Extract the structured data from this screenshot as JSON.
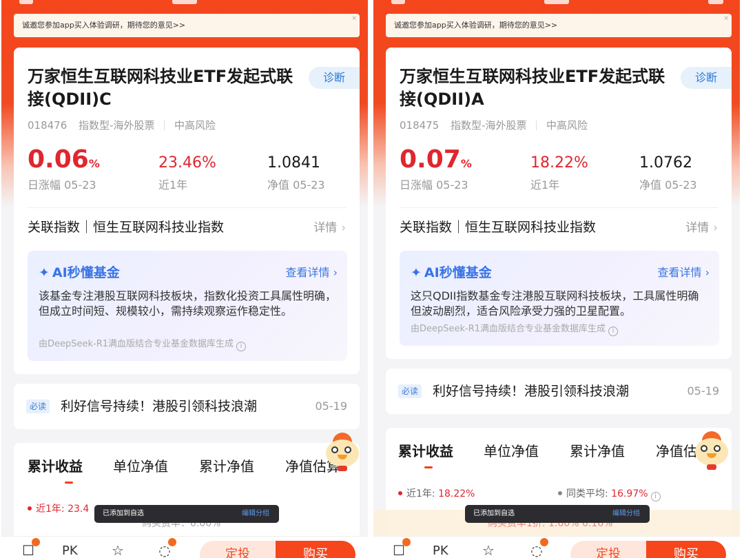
{
  "invite_banner": {
    "text": "诚邀您参加app买入体验调研，期待您的意见>>",
    "close_glyph": "×"
  },
  "panels": [
    {
      "fund": {
        "name": "万家恒生互联网科技业ETF发起式联接(QDII)C",
        "diagnose_label": "诊断",
        "code": "018476",
        "category": "指数型-海外股票",
        "risk": "中高风险",
        "daily_change_number": "0.06",
        "daily_change_unit": "%",
        "daily_change_label": "日涨幅 05-23",
        "one_year_return": "23.46%",
        "one_year_label": "近1年",
        "nav": "1.0841",
        "nav_label": "净值 05-23"
      },
      "index": {
        "label": "关联指数｜恒生互联网科技业指数",
        "detail_label": "详情",
        "chevron": "›"
      },
      "ai": {
        "spark_icon": "✦",
        "title": "AI秒懂基金",
        "more_label": "查看详情 ›",
        "body": "该基金专注港股互联网科技板块，指数化投资工具属性明确，但成立时间短、规模较小，需持续观察运作稳定性。",
        "source": "由DeepSeek-R1满血版结合专业基金数据库生成",
        "info_glyph": "i"
      },
      "news": {
        "badge": "必读",
        "title": "利好信号持续！港股引领科技浪潮",
        "date": "05-19"
      },
      "tabs": [
        "累计收益",
        "单位净值",
        "累计净值",
        "净值估算"
      ],
      "stats": {
        "one_year": "近1年: 23.4",
        "peer_avg": "",
        "peer_avg_value": ""
      },
      "toast": {
        "text": "已添加到自选",
        "action": "编辑分组"
      },
      "fee_row": "购买费率：0.00%",
      "bottom_bar": {
        "pk_label": "PK",
        "sell_label": "定投",
        "buy_label": "购买"
      }
    },
    {
      "fund": {
        "name": "万家恒生互联网科技业ETF发起式联接(QDII)A",
        "diagnose_label": "诊断",
        "code": "018475",
        "category": "指数型-海外股票",
        "risk": "中高风险",
        "daily_change_number": "0.07",
        "daily_change_unit": "%",
        "daily_change_label": "日涨幅 05-23",
        "one_year_return": "18.22%",
        "one_year_label": "近1年",
        "nav": "1.0762",
        "nav_label": "净值 05-23"
      },
      "index": {
        "label": "关联指数｜恒生互联网科技业指数",
        "detail_label": "详情",
        "chevron": "›"
      },
      "ai": {
        "spark_icon": "✦",
        "title": "AI秒懂基金",
        "more_label": "查看详情 ›",
        "body": "这只QDII指数基金专注港股互联网科技板块，工具属性明确但波动剧烈，适合风险承受力强的卫星配置。",
        "source": "由DeepSeek-R1满血版结合专业基金数据库生成",
        "info_glyph": "i"
      },
      "news": {
        "badge": "必读",
        "title": "利好信号持续！港股引领科技浪潮",
        "date": "05-19"
      },
      "tabs": [
        "累计收益",
        "单位净值",
        "累计净值",
        "净值估算"
      ],
      "stats": {
        "one_year": "近1年: ",
        "one_year_value": "18.22%",
        "peer_avg": "同类平均: ",
        "peer_avg_value": "16.97%"
      },
      "toast": {
        "text": "已添加到自选",
        "action": "编辑分组"
      },
      "fee_row": "购买费率1折: 1.60% 0.16%",
      "bottom_bar": {
        "pk_label": "PK",
        "sell_label": "定投",
        "buy_label": "购买"
      }
    }
  ],
  "colors": {
    "brand_orange": "#f5461c",
    "rise_red": "#e0262e",
    "link_blue": "#3a78e0"
  }
}
